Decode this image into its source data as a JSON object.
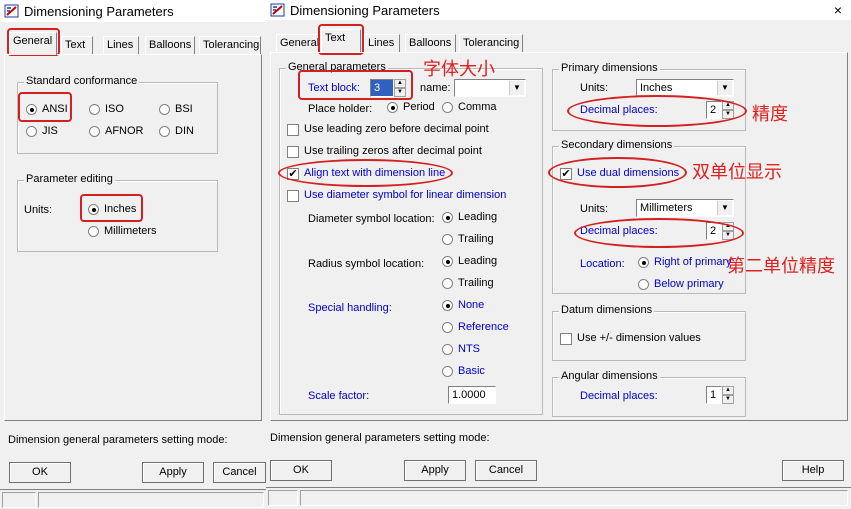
{
  "accent_red": "#d42020",
  "left_window": {
    "title": "Dimensioning Parameters",
    "icon": "dimension-app-icon",
    "tabs": [
      "General",
      "Text",
      "Lines",
      "Balloons",
      "Tolerancing"
    ],
    "active_tab": "General",
    "standard": {
      "title": "Standard conformance",
      "options": [
        "ANSI",
        "ISO",
        "BSI",
        "JIS",
        "AFNOR",
        "DIN"
      ],
      "selected": "ANSI"
    },
    "param_edit": {
      "title": "Parameter editing",
      "units_label": "Units:",
      "options": [
        "Inches",
        "Millimeters"
      ],
      "selected": "Inches"
    },
    "status_text": "Dimension general parameters setting mode:",
    "buttons": {
      "ok": "OK",
      "apply": "Apply",
      "cancel": "Cancel"
    }
  },
  "right_window": {
    "title": "Dimensioning Parameters",
    "close_glyph": "×",
    "tabs": [
      "General",
      "Text",
      "Lines",
      "Balloons",
      "Tolerancing"
    ],
    "active_tab": "Text",
    "general": {
      "title": "General parameters",
      "text_block_label": "Text block:",
      "text_block_value": "3",
      "name_label": "name:",
      "name_value": "",
      "place_holder_label": "Place holder:",
      "place_holder_options": [
        "Period",
        "Comma"
      ],
      "place_holder_selected": "Period",
      "leading_zero": "Use leading zero before decimal point",
      "trailing_zeros": "Use trailing zeros after decimal point",
      "align_text": "Align text with dimension line",
      "align_checked": true,
      "diameter_symbol": "Use diameter symbol for linear dimension",
      "diameter_loc_label": "Diameter symbol location:",
      "diameter_loc_options": [
        "Leading",
        "Trailing"
      ],
      "diameter_loc_selected": "Leading",
      "radius_loc_label": "Radius symbol location:",
      "radius_loc_options": [
        "Leading",
        "Trailing"
      ],
      "radius_loc_selected": "Leading",
      "special_label": "Special handling:",
      "special_options": [
        "None",
        "Reference",
        "NTS",
        "Basic"
      ],
      "special_selected": "None",
      "scale_label": "Scale factor:",
      "scale_value": "1.0000"
    },
    "primary": {
      "title": "Primary dimensions",
      "units_label": "Units:",
      "units_value": "Inches",
      "decimal_label": "Decimal places:",
      "decimal_value": "2"
    },
    "secondary": {
      "title": "Secondary dimensions",
      "dual_label": "Use dual dimensions",
      "dual_checked": true,
      "units_label": "Units:",
      "units_value": "Millimeters",
      "decimal_label": "Decimal places:",
      "decimal_value": "2",
      "location_label": "Location:",
      "location_options": [
        "Right of primary",
        "Below primary"
      ],
      "location_selected": "Right of primary"
    },
    "datum": {
      "title": "Datum dimensions",
      "pm_label": "Use +/- dimension values"
    },
    "angular": {
      "title": "Angular dimensions",
      "decimal_label": "Decimal places:",
      "decimal_value": "1"
    },
    "status_text": "Dimension general parameters setting mode:",
    "buttons": {
      "ok": "OK",
      "apply": "Apply",
      "cancel": "Cancel",
      "help": "Help"
    }
  },
  "annotations": {
    "font_size": "字体大小",
    "precision": "精度",
    "dual_unit": "双单位显示",
    "second_precision": "第二单位精度"
  }
}
